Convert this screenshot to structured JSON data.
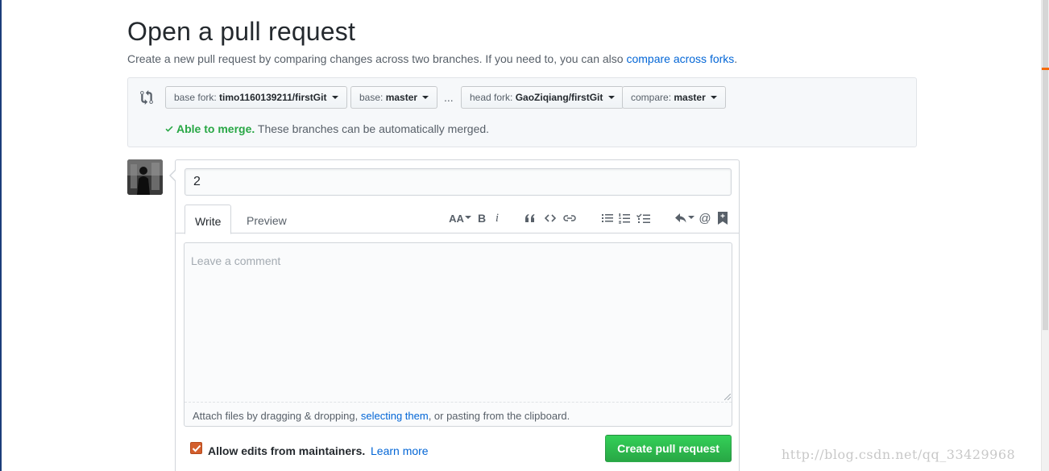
{
  "header": {
    "title": "Open a pull request",
    "subtitle_text": "Create a new pull request by comparing changes across two branches. If you need to, you can also ",
    "subtitle_link": "compare across forks",
    "subtitle_end": "."
  },
  "range": {
    "base_fork_label": "base fork:",
    "base_fork_value": "timo1160139211/firstGit",
    "base_label": "base:",
    "base_value": "master",
    "ellipsis": "...",
    "head_fork_label": "head fork:",
    "head_fork_value": "GaoZiqiang/firstGit",
    "compare_label": "compare:",
    "compare_value": "master",
    "merge_ok": "Able to merge.",
    "merge_text": " These branches can be automatically merged."
  },
  "form": {
    "title_value": "2",
    "tab_write": "Write",
    "tab_preview": "Preview",
    "comment_placeholder": "Leave a comment",
    "attach_text_1": "Attach files by dragging & dropping, ",
    "attach_link": "selecting them",
    "attach_text_2": ", or pasting from the clipboard.",
    "allow_edits_label": "Allow edits from maintainers.",
    "learn_more": "Learn more",
    "create_button": "Create pull request",
    "allow_edits_checked": true
  },
  "toolbar": {
    "header_icon": "text-size-icon",
    "header_label": "AA",
    "bold_label": "B",
    "italic_label": "i",
    "icons": [
      "text-size-icon",
      "bold-icon",
      "italic-icon",
      "quote-icon",
      "code-icon",
      "link-icon",
      "unordered-list-icon",
      "ordered-list-icon",
      "task-list-icon",
      "reply-icon",
      "mention-icon",
      "saved-reply-icon"
    ]
  },
  "watermark": "http://blog.csdn.net/qq_33429968",
  "colors": {
    "link": "#0366d6",
    "success": "#28a745",
    "button_green": "#2cbe4e",
    "checkbox": "#d35f2d"
  }
}
